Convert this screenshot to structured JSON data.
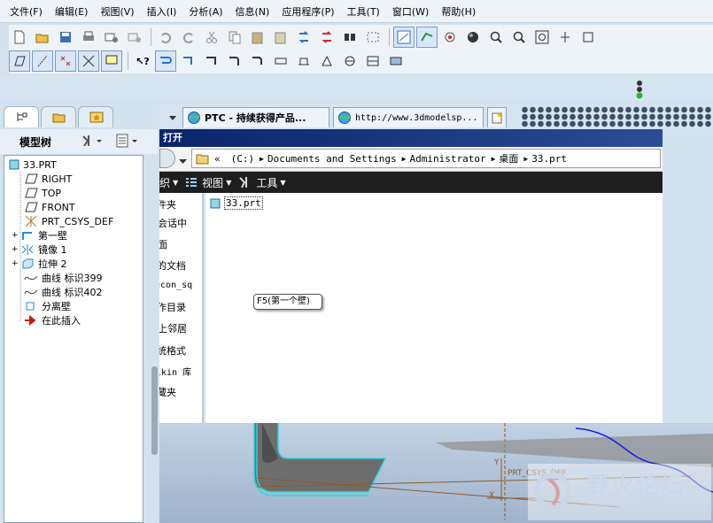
{
  "menu": [
    "文件(F)",
    "编辑(E)",
    "视图(V)",
    "插入(I)",
    "分析(A)",
    "信息(N)",
    "应用程序(P)",
    "工具(T)",
    "窗口(W)",
    "帮助(H)"
  ],
  "model_tree": {
    "title": "模型树",
    "items": [
      {
        "label": "33.PRT",
        "icon": "part-icon"
      },
      {
        "label": "RIGHT",
        "icon": "datum-plane-icon"
      },
      {
        "label": "TOP",
        "icon": "datum-plane-icon"
      },
      {
        "label": "FRONT",
        "icon": "datum-plane-icon"
      },
      {
        "label": "PRT_CSYS_DEF",
        "icon": "csys-icon"
      },
      {
        "label": "第一壁",
        "icon": "wall-icon"
      },
      {
        "label": "镜像 1",
        "icon": "mirror-icon"
      },
      {
        "label": "拉伸 2",
        "icon": "extrude-icon"
      },
      {
        "label": "曲线 标识399",
        "icon": "curve-icon"
      },
      {
        "label": "曲线 标识402",
        "icon": "curve-icon"
      },
      {
        "label": "分离壁",
        "icon": "wall-icon"
      },
      {
        "label": "在此插入",
        "icon": "insert-arrow-icon"
      }
    ]
  },
  "browser_tabs": [
    {
      "label": "PTC - 持续获得产品..."
    },
    {
      "label": "http://www.3dmodelsp..."
    }
  ],
  "dialog": {
    "title": "打开",
    "address": {
      "chevron": "«",
      "parts": [
        "(C:)",
        "Documents and Settings",
        "Administrator",
        "桌面",
        "33.prt"
      ]
    },
    "toolbar": {
      "organize": "织",
      "views": "视图",
      "tools": "工具"
    },
    "nav": [
      "件夹",
      "会话中",
      "面",
      "的文档",
      "econ_sq",
      "作目录",
      "上邻居",
      "统格式",
      "ikin 库",
      "藏夹"
    ],
    "files": [
      {
        "name": "33.prt"
      }
    ]
  },
  "tooltip": "F5(第一个壁)",
  "model_labels": {
    "csys": "PRT_CSYS_DEF",
    "axis_y": "Y",
    "axis_x": "X"
  },
  "watermark": {
    "text": "野火论坛",
    "url": "www.proewildfire.cn"
  },
  "colors": {
    "title_bar": "#0a246a",
    "wall_highlight": "#27d8d8",
    "curve": "#1a1ad8",
    "tree_bg": "#ffffff"
  }
}
